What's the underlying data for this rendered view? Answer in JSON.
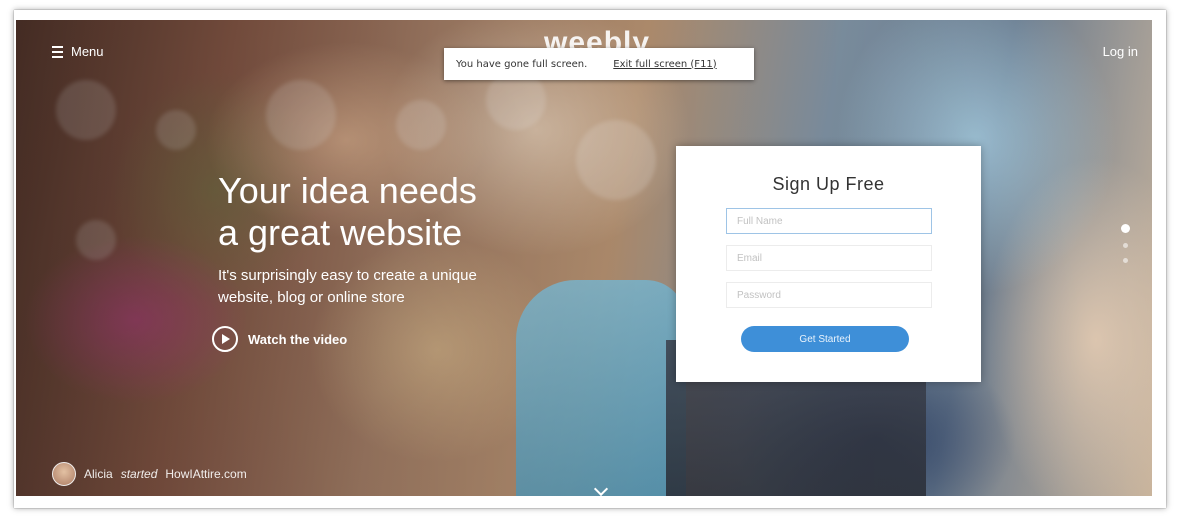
{
  "nav": {
    "menu_label": "Menu",
    "logo_text": "weebly",
    "login_label": "Log in"
  },
  "fullscreen_notice": {
    "message": "You have gone full screen.",
    "exit_label": "Exit full screen (F11)"
  },
  "hero": {
    "headline_line1": "Your idea needs",
    "headline_line2": "a great website",
    "subhead_line1": "It's surprisingly easy to create a unique",
    "subhead_line2": "website, blog or online store",
    "watch_label": "Watch the video"
  },
  "signup": {
    "title": "Sign Up Free",
    "full_name_placeholder": "Full Name",
    "email_placeholder": "Email",
    "password_placeholder": "Password",
    "submit_label": "Get Started"
  },
  "carousel": {
    "slide_count": 3,
    "active_index": 0
  },
  "attribution": {
    "name": "Alicia",
    "verb": "started",
    "site": "HowIAttire.com"
  },
  "colors": {
    "accent": "#3e8fd8",
    "overlay_text": "#ffffff"
  }
}
